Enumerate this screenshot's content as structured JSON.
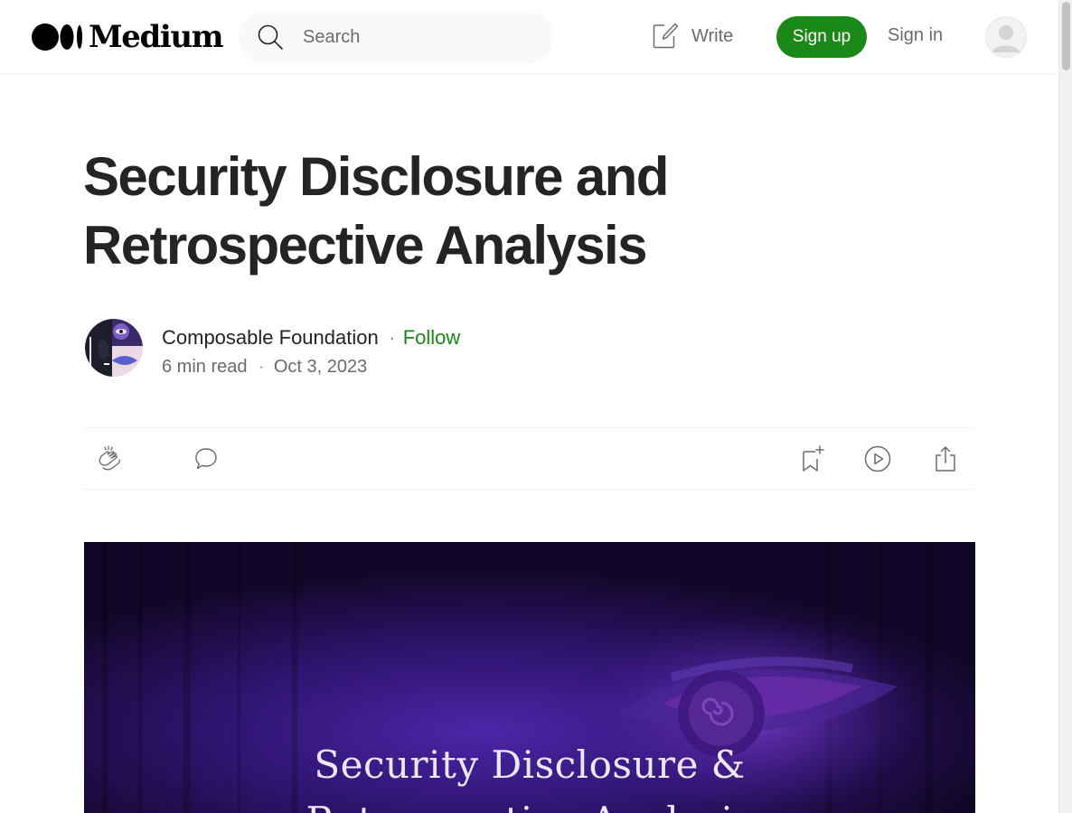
{
  "header": {
    "logo_text": "Medium",
    "search_placeholder": "Search",
    "write_label": "Write",
    "signup_label": "Sign up",
    "signin_label": "Sign in"
  },
  "article": {
    "title": "Security Disclosure and Retrospective Analysis",
    "author": "Composable Foundation",
    "follow_label": "Follow",
    "separator": "·",
    "read_time": "6 min read",
    "date": "Oct 3, 2023"
  },
  "hero": {
    "title_line1": "Security Disclosure &",
    "title_line2": "Retrospective Analysis"
  },
  "icons": {
    "search": "search-icon",
    "write": "write-icon",
    "clap": "clap-icon",
    "comment": "comment-icon",
    "bookmark": "bookmark-add-icon",
    "listen": "play-icon",
    "share": "share-icon"
  },
  "colors": {
    "brand_green": "#1a8917",
    "text": "#242424",
    "muted": "#6b6b6b",
    "hero_bg": "#1c0c38"
  }
}
